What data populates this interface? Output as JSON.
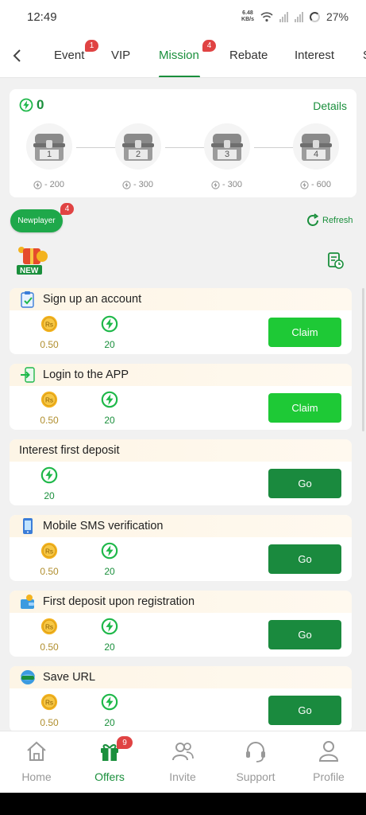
{
  "status": {
    "time": "12:49",
    "speed_value": "6.48",
    "speed_unit": "KB/s",
    "battery": "27%"
  },
  "tabs": [
    {
      "label": "Event",
      "badge": "1"
    },
    {
      "label": "VIP"
    },
    {
      "label": "Mission",
      "badge": "4",
      "active": true
    },
    {
      "label": "Rebate"
    },
    {
      "label": "Interest"
    },
    {
      "label": "S"
    }
  ],
  "progress": {
    "points": "0",
    "details_label": "Details",
    "chests": [
      {
        "number": "1",
        "reward": "200"
      },
      {
        "number": "2",
        "reward": "300"
      },
      {
        "number": "3",
        "reward": "300"
      },
      {
        "number": "4",
        "reward": "600"
      }
    ]
  },
  "filter": {
    "label": "Newplayer",
    "badge": "4",
    "refresh_label": "Refresh",
    "new_tag": "NEW"
  },
  "tasks": [
    {
      "title": "Sign up an account",
      "cash": "0.50",
      "cash_symbol": "Rs",
      "points": "20",
      "action": "Claim",
      "type": "claim"
    },
    {
      "title": "Login to the APP",
      "cash": "0.50",
      "cash_symbol": "Rs",
      "points": "20",
      "action": "Claim",
      "type": "claim"
    },
    {
      "title": "Interest first deposit",
      "points": "20",
      "action": "Go",
      "type": "go"
    },
    {
      "title": "Mobile SMS verification",
      "cash": "0.50",
      "cash_symbol": "Rs",
      "points": "20",
      "action": "Go",
      "type": "go"
    },
    {
      "title": "First deposit upon registration",
      "cash": "0.50",
      "cash_symbol": "Rs",
      "points": "20",
      "action": "Go",
      "type": "go"
    },
    {
      "title": "Save URL",
      "cash": "0.50",
      "cash_symbol": "Rs",
      "points": "20",
      "action": "Go",
      "type": "go"
    }
  ],
  "bottom_nav": [
    {
      "label": "Home",
      "icon": "home-icon"
    },
    {
      "label": "Offers",
      "icon": "gift-icon",
      "badge": "9",
      "active": true
    },
    {
      "label": "Invite",
      "icon": "invite-icon"
    },
    {
      "label": "Support",
      "icon": "headset-icon"
    },
    {
      "label": "Profile",
      "icon": "profile-icon"
    }
  ],
  "colors": {
    "accent": "#1a8f3c",
    "claim": "#1ec936",
    "go": "#1a8a3e",
    "badge": "#e04343",
    "coin": "#f3b31f"
  }
}
